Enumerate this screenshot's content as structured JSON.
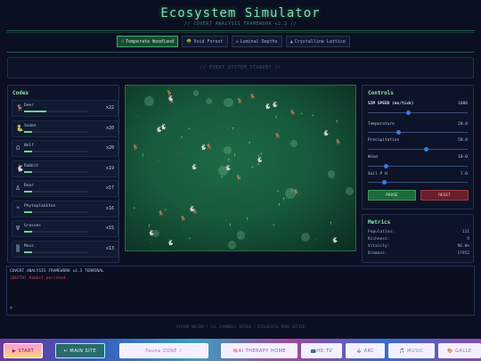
{
  "header": {
    "title": "Ecosystem Simulator",
    "subtitle": "// COVERT ANALYSIS FRAMEWORK v2.3 //"
  },
  "tabs": [
    {
      "icon": "♧",
      "label": "Temperate Woodland",
      "active": true
    },
    {
      "icon": "🌳",
      "label": "Void Forest",
      "active": false
    },
    {
      "icon": "≈",
      "label": "Luminal Depths",
      "active": false
    },
    {
      "icon": "▲",
      "label": "Crystalline Lattice",
      "active": false
    }
  ],
  "banner": {
    "text": "// EVENT SYSTEM STANDBY //"
  },
  "codex": {
    "title": "Codex",
    "items": [
      {
        "icon": "🦌",
        "name": "Deer",
        "count": "x22",
        "level": 0.35
      },
      {
        "icon": "🐍",
        "name": "Snake",
        "count": "x20",
        "level": 0.12
      },
      {
        "icon": "Ω",
        "name": "Wolf",
        "count": "x20",
        "level": 0.12
      },
      {
        "icon": "🐇",
        "name": "Rabbit",
        "count": "x19",
        "level": 0.12
      },
      {
        "icon": "Δ",
        "name": "Bear",
        "count": "x17",
        "level": 0.12
      },
      {
        "icon": "*",
        "name": "Phytoplankton",
        "count": "x16",
        "level": 0.12
      },
      {
        "icon": "Ψ",
        "name": "Grasses",
        "count": "x15",
        "level": 0.12
      },
      {
        "icon": "▒",
        "name": "Moss",
        "count": "x13",
        "level": 0.12
      }
    ]
  },
  "controls": {
    "title": "Controls",
    "sim_speed": {
      "label": "SIM SPEED (ms/tick)",
      "value": "1000",
      "level": 0.4
    },
    "temperature": {
      "label": "Temperature",
      "value": "20.0",
      "level": 0.3
    },
    "precipitation": {
      "label": "Precipitation",
      "value": "50.0",
      "level": 0.58
    },
    "wind": {
      "label": "Wind",
      "value": "10.0",
      "level": 0.18
    },
    "soil": {
      "label": "Soil P H",
      "value": "7.0",
      "level": 0.16
    },
    "pause_label": "PAUSE",
    "reset_label": "RESET"
  },
  "metrics": {
    "title": "Metrics",
    "rows": [
      {
        "label": "Population:",
        "value": "111"
      },
      {
        "label": "Richness:",
        "value": "9"
      },
      {
        "label": "Vitality:",
        "value": "98.0%"
      },
      {
        "label": "Biomass:",
        "value": "17952"
      }
    ]
  },
  "terminal": {
    "header": "COVERT ANALYSIS FRAMEWORK v2.3 TERMINAL",
    "log_line": "[DEATH] Rabbit perished.",
    "prompt": ">"
  },
  "footer_status": "SYSTEM ONLINE | ALL CHANNELS SECURE | ECOLOGICAL MODE ACTIVE",
  "bottom_nav": {
    "start": "▶ START",
    "main_site": "↩ MAIN SITE",
    "fauna_zone": "Fauna ZONE ♪",
    "ai_therapy": "🧠AI THERAPY HOME",
    "hd_tv": "📺HD.TV",
    "arc": "🕹 ARC",
    "music": "🎵 MUSIC",
    "gallery": "🎨 GALLE"
  },
  "colors": {
    "accent": "#7fe3a8",
    "pause_bg": "#1f6a3c",
    "reset_bg": "#6a1e2c",
    "death_text": "#c8465a"
  }
}
